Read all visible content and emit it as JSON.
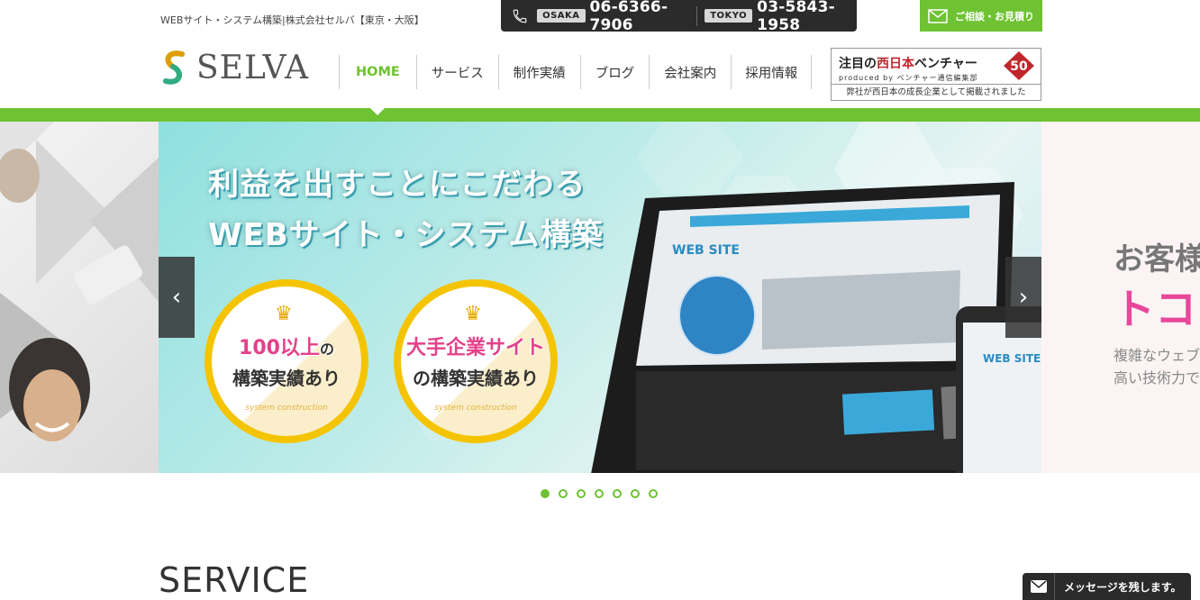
{
  "header": {
    "tagline": "WEBサイト・システム構築|株式会社セルバ【東京・大阪】",
    "phones": [
      {
        "city": "OSAKA",
        "number": "06-6366-7906"
      },
      {
        "city": "TOKYO",
        "number": "03-5843-1958"
      }
    ],
    "consult_label": "ご相談・お見積り",
    "logo_text": "SELVA"
  },
  "nav": {
    "items": [
      "HOME",
      "サービス",
      "制作実績",
      "ブログ",
      "会社案内",
      "採用情報"
    ]
  },
  "badge": {
    "title_prefix": "注目の",
    "title_red": "西日本",
    "title_suffix": "ベンチャー",
    "number": "50",
    "subtitle": "produced by ベンチャー通信編集部",
    "bottom": "弊社が西日本の成長企業として掲載されました"
  },
  "slider": {
    "headline1": "利益を出すことにこだわる",
    "headline2": "WEBサイト・システム構築",
    "medal1": {
      "big": "100以上",
      "small": "の",
      "line2": "構築実績あり",
      "foot": "system construction"
    },
    "medal2": {
      "big": "大手企業サイト",
      "line2": "の構築実績あり",
      "foot": "system construction"
    },
    "right_text1": "お客様",
    "right_text2": "トコ",
    "right_text3": "複雑なウェブ",
    "right_text4": "高い技術力で",
    "prev_arrow": "‹",
    "next_arrow": "›",
    "dot_count": 7,
    "active_dot": 1
  },
  "section": {
    "title": "SERVICE"
  },
  "message": {
    "label": "メッセージを残します。"
  },
  "colors": {
    "brand_green": "#6fc232",
    "dark": "#2b2b2b",
    "pink": "#e8479a"
  }
}
